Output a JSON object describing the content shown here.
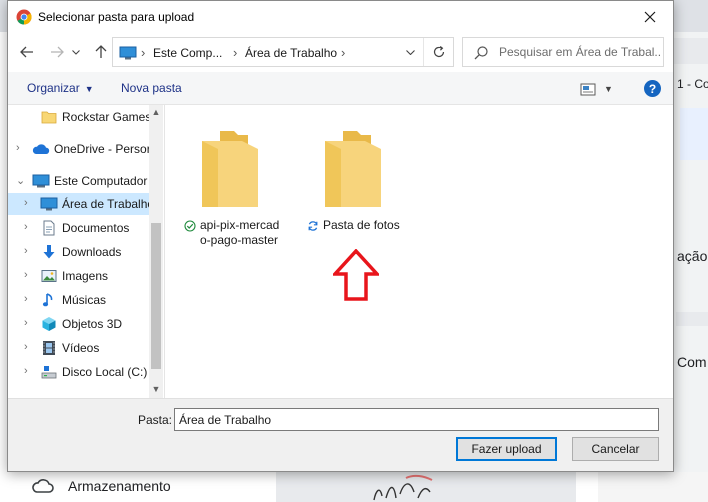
{
  "dialog": {
    "title": "Selecionar pasta para upload",
    "nav": {
      "back_icon": "arrow-left-icon",
      "forward_icon": "arrow-right-icon",
      "up_icon": "arrow-up-icon"
    },
    "address": {
      "segments": [
        "Este Comp...",
        "Área de Trabalho"
      ],
      "separator": "›"
    },
    "search": {
      "placeholder": "Pesquisar em Área de Trabal..."
    },
    "toolbar": {
      "organize_label": "Organizar",
      "new_folder_label": "Nova pasta",
      "help_label": "?"
    },
    "sidebar": {
      "items": [
        {
          "label": "Rockstar Games",
          "icon": "folder-icon"
        },
        {
          "label": "OneDrive - Persor",
          "icon": "cloud-icon"
        },
        {
          "label": "Este Computador",
          "icon": "computer-icon"
        },
        {
          "label": "Área de Trabalho",
          "icon": "desktop-icon",
          "selected": true
        },
        {
          "label": "Documentos",
          "icon": "document-icon"
        },
        {
          "label": "Downloads",
          "icon": "download-icon"
        },
        {
          "label": "Imagens",
          "icon": "picture-icon"
        },
        {
          "label": "Músicas",
          "icon": "music-icon"
        },
        {
          "label": "Objetos 3D",
          "icon": "cube-icon"
        },
        {
          "label": "Vídeos",
          "icon": "film-icon"
        },
        {
          "label": "Disco Local (C:)",
          "icon": "drive-icon"
        }
      ]
    },
    "files": [
      {
        "name": "api-pix-mercado-pago-master",
        "status": "synced-check-icon"
      },
      {
        "name": "Pasta de fotos",
        "status": "sync-pending-icon"
      }
    ],
    "folder_field": {
      "label": "Pasta:",
      "value": "Área de Trabalho"
    },
    "buttons": {
      "upload": "Fazer upload",
      "cancel": "Cancelar"
    }
  },
  "background": {
    "storage_label": "Armazenamento",
    "right_snippets": [
      "1 - Co",
      "ação",
      "Com"
    ]
  },
  "colors": {
    "accent": "#0078d7",
    "selection": "#cce8ff",
    "folder": "#f5d27a",
    "arrow": "#e8151b",
    "link": "#1e3287"
  }
}
